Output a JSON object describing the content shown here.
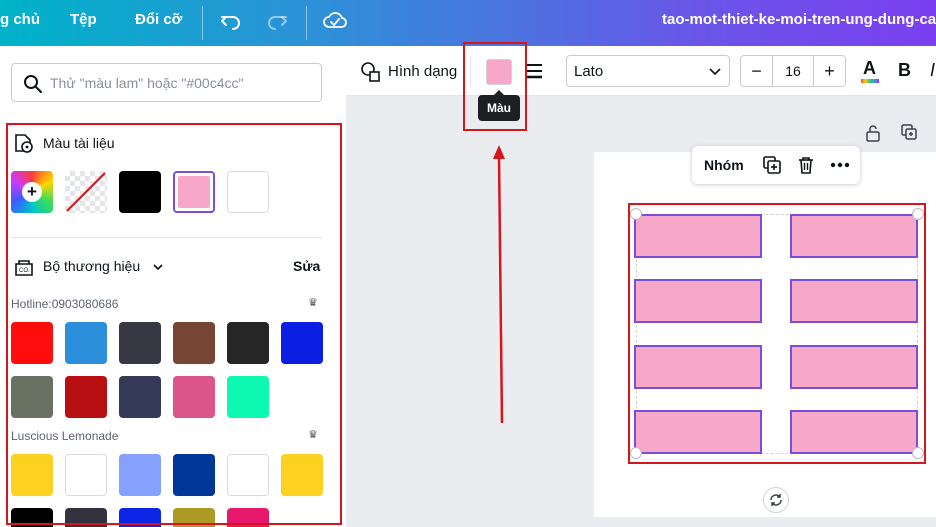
{
  "topbar": {
    "home_label": "g chủ",
    "file_label": "Tệp",
    "resize_label": "Đổi cỡ",
    "doc_title": "tao-mot-thiet-ke-moi-tren-ung-dung-canva"
  },
  "left_panel": {
    "search_placeholder": "Thử \"màu lam\" hoặc \"#00c4cc\"",
    "doc_colors_title": "Màu tài liệu",
    "doc_colors": [
      "rainbow-add",
      "transparent",
      "#000000",
      "#f7a8c8",
      "#ffffff"
    ],
    "brand_kit_title": "Bộ thương hiệu",
    "edit_label": "Sửa",
    "palettes": [
      {
        "name": "Hotline:0903080686",
        "colors": [
          "#ff0d0d",
          "#2b8fdb",
          "#383845",
          "#764534",
          "#262626",
          "#0b1fe3",
          "#697262",
          "#b80f12",
          "#343a55",
          "#dc5689",
          "#0df8b0"
        ]
      },
      {
        "name": "Luscious Lemonade",
        "colors": [
          "#fdd11f",
          "#ffffff",
          "#86a1fb",
          "#013796",
          "#ffffff",
          "#fdd11f",
          "#000000",
          "#33333f",
          "#0c26e5",
          "#ac9a25",
          "#e6186c"
        ]
      }
    ]
  },
  "toolbar": {
    "shape_label": "Hình dạng",
    "color_tooltip": "Màu",
    "current_color": "#f7a8c8",
    "font_name": "Lato",
    "font_size": "16",
    "minus_label": "−",
    "plus_label": "+",
    "text_color_label": "A",
    "bold_label": "B",
    "italic_label": "I"
  },
  "canvas": {
    "group_label": "Nhóm",
    "shape_fill": "#f7a8c8",
    "shape_stroke": "#7b4ddc"
  },
  "annotation_color": "#d5161c"
}
